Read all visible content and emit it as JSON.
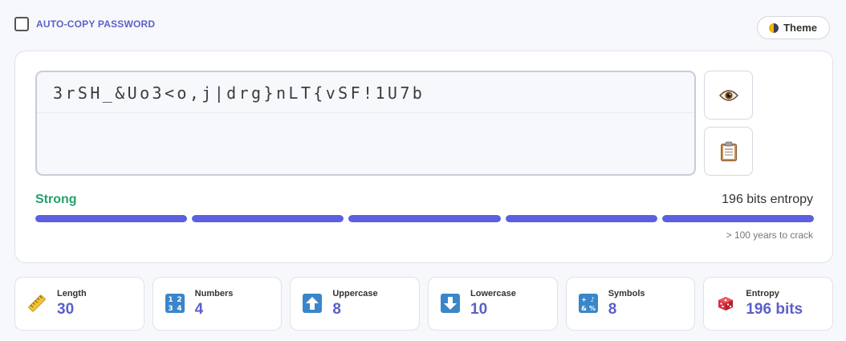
{
  "header": {
    "autocopy_label": "AUTO-COPY PASSWORD",
    "autocopy_checked": false,
    "theme_label": "Theme",
    "theme_icon": "half-moon-icon"
  },
  "password": {
    "value": "3rSH_&Uo3<o,j|drg}nLT{vSF!1U7b",
    "show_icon": "eye-icon",
    "copy_icon": "clipboard-icon"
  },
  "strength": {
    "label": "Strong",
    "entropy_text": "196 bits entropy",
    "crack_time": "> 100 years to crack",
    "segments": [
      1,
      1,
      1,
      1,
      1
    ],
    "colors": {
      "strong": "#27a06c",
      "bar": "#5b5fe0",
      "bar_empty": "#e4e6f0"
    }
  },
  "stats": [
    {
      "label": "Length",
      "value": "30",
      "icon": "ruler-icon"
    },
    {
      "label": "Numbers",
      "value": "4",
      "icon": "numbers-icon"
    },
    {
      "label": "Uppercase",
      "value": "8",
      "icon": "up-arrow-icon"
    },
    {
      "label": "Lowercase",
      "value": "10",
      "icon": "down-arrow-icon"
    },
    {
      "label": "Symbols",
      "value": "8",
      "icon": "symbols-icon"
    },
    {
      "label": "Entropy",
      "value": "196 bits",
      "icon": "dice-icon"
    }
  ]
}
